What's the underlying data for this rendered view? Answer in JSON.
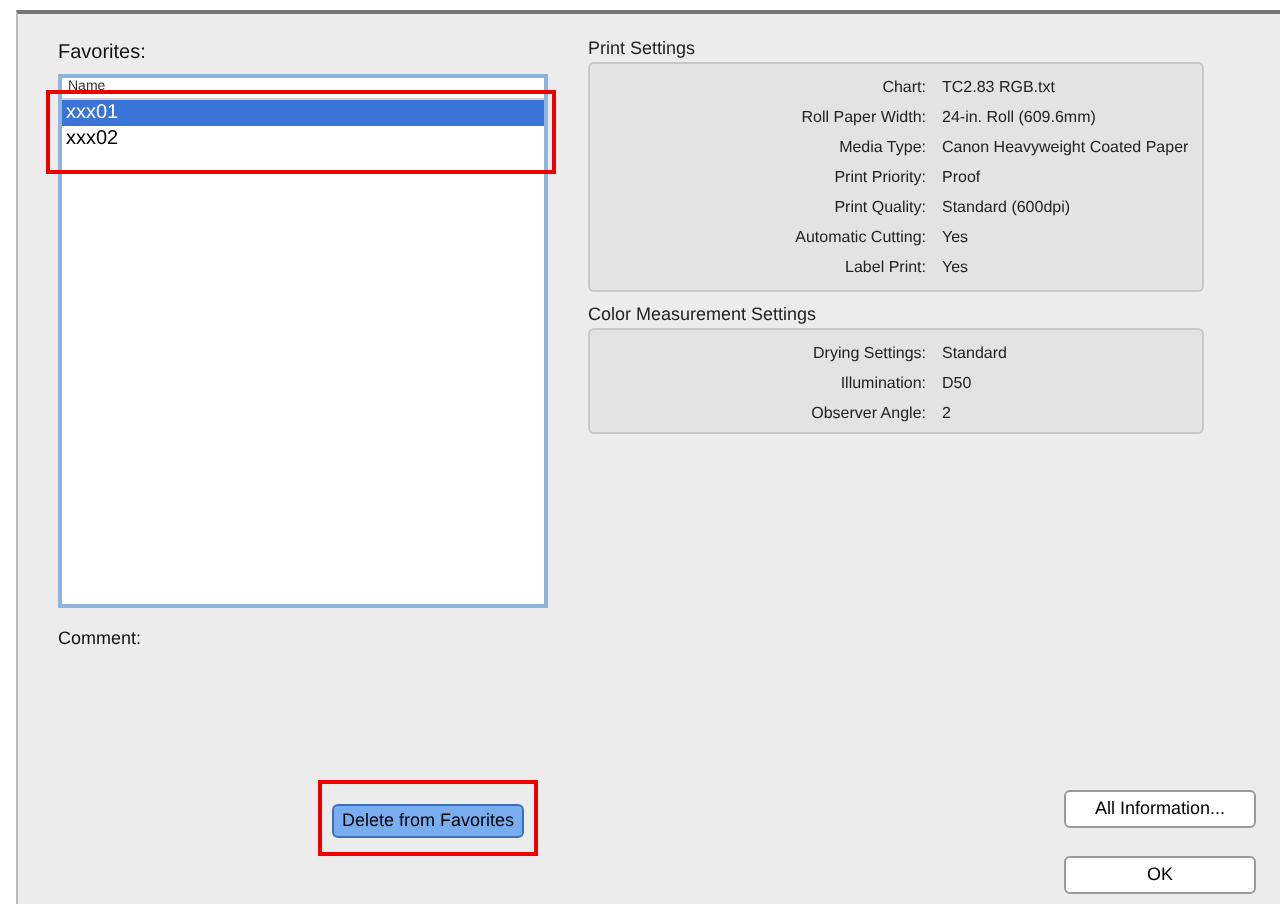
{
  "favorites": {
    "label": "Favorites:",
    "column": "Name",
    "items": [
      {
        "name": "xxx01",
        "selected": true
      },
      {
        "name": "xxx02",
        "selected": false
      }
    ]
  },
  "comment": {
    "label": "Comment:"
  },
  "print_settings": {
    "title": "Print Settings",
    "rows": [
      {
        "label": "Chart:",
        "value": "TC2.83 RGB.txt"
      },
      {
        "label": "Roll Paper Width:",
        "value": "24-in. Roll (609.6mm)"
      },
      {
        "label": "Media Type:",
        "value": "Canon Heavyweight Coated Paper"
      },
      {
        "label": "Print Priority:",
        "value": "Proof"
      },
      {
        "label": "Print Quality:",
        "value": "Standard (600dpi)"
      },
      {
        "label": "Automatic Cutting:",
        "value": "Yes"
      },
      {
        "label": "Label Print:",
        "value": "Yes"
      }
    ]
  },
  "color_measurement_settings": {
    "title": "Color Measurement Settings",
    "rows": [
      {
        "label": "Drying Settings:",
        "value": "Standard"
      },
      {
        "label": "Illumination:",
        "value": "D50"
      },
      {
        "label": "Observer Angle:",
        "value": "2"
      }
    ]
  },
  "buttons": {
    "delete": "Delete from Favorites",
    "all_information": "All Information...",
    "ok": "OK"
  }
}
